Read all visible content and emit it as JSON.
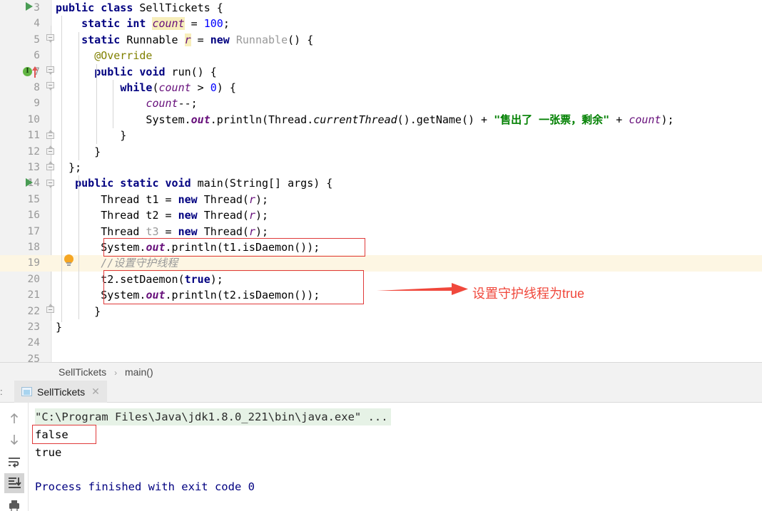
{
  "editor": {
    "first_line_number": 3,
    "lines": [
      {
        "n": 3,
        "text": "public class SellTickets {"
      },
      {
        "n": 4,
        "text": "    static int count = 100;"
      },
      {
        "n": 5,
        "text": "    static Runnable r = new Runnable() {"
      },
      {
        "n": 6,
        "text": "        @Override"
      },
      {
        "n": 7,
        "text": "        public void run() {"
      },
      {
        "n": 8,
        "text": "            while(count > 0) {"
      },
      {
        "n": 9,
        "text": "                count--;"
      },
      {
        "n": 10,
        "text": "                System.out.println(Thread.currentThread().getName() + \"售出了 一张票，剩余\" + count);"
      },
      {
        "n": 11,
        "text": "            }"
      },
      {
        "n": 12,
        "text": "        }"
      },
      {
        "n": 13,
        "text": "    };"
      },
      {
        "n": 14,
        "text": "    public static void main(String[] args) {"
      },
      {
        "n": 15,
        "text": "        Thread t1 = new Thread(r);"
      },
      {
        "n": 16,
        "text": "        Thread t2 = new Thread(r);"
      },
      {
        "n": 17,
        "text": "        Thread t3 = new Thread(r);"
      },
      {
        "n": 18,
        "text": "        System.out.println(t1.isDaemon());"
      },
      {
        "n": 19,
        "text": "        //设置守护线程"
      },
      {
        "n": 20,
        "text": "        t2.setDaemon(true);"
      },
      {
        "n": 21,
        "text": "        System.out.println(t2.isDaemon());"
      },
      {
        "n": 22,
        "text": "        }"
      },
      {
        "n": 23,
        "text": "}"
      },
      {
        "n": 24,
        "text": ""
      },
      {
        "n": 25,
        "text": ""
      }
    ],
    "highlighted_line": 19,
    "run_marker_lines": [
      3,
      14
    ],
    "override_marker_line": 7,
    "bulb_line": 19
  },
  "annotation": {
    "arrow_label": "设置守护线程为true",
    "color": "#f0483c"
  },
  "breadcrumb": {
    "class": "SellTickets",
    "separator": "›",
    "method": "main()"
  },
  "run_panel": {
    "tab_prefix": ":",
    "tab_label": "SellTickets",
    "tab_close": "✕",
    "tools": [
      {
        "name": "up-arrow-icon",
        "title": "Up"
      },
      {
        "name": "down-arrow-icon",
        "title": "Down"
      },
      {
        "name": "soft-wrap-icon",
        "title": "Soft-Wrap"
      },
      {
        "name": "scroll-to-end-icon",
        "title": "Scroll to End"
      },
      {
        "name": "print-icon",
        "title": "Print"
      }
    ],
    "console_lines": [
      {
        "kind": "cmd",
        "text": "\"C:\\Program Files\\Java\\jdk1.8.0_221\\bin\\java.exe\" ..."
      },
      {
        "kind": "out",
        "text": "false"
      },
      {
        "kind": "out",
        "text": "true"
      },
      {
        "kind": "out",
        "text": ""
      },
      {
        "kind": "fin",
        "text": "Process finished with exit code 0"
      }
    ]
  },
  "colors": {
    "keyword": "#000080",
    "string": "#008000",
    "number": "#0000ff",
    "field": "#660e7a",
    "annotation": "#808000",
    "comment": "#999999",
    "highlight_row": "#fdf6e3",
    "console_cmd_bg": "#e6f2e6",
    "red_box": "#e03a3a"
  }
}
